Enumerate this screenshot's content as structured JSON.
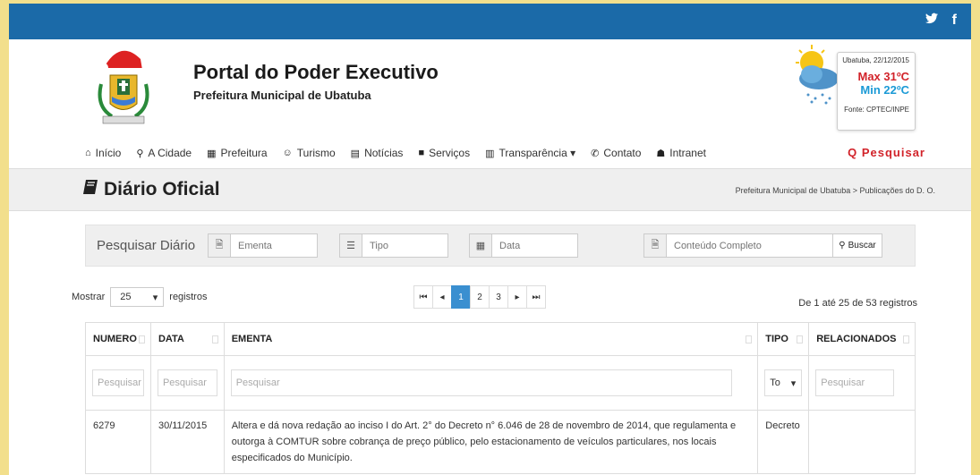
{
  "social": {
    "twitter": "𝕪",
    "facebook": "f"
  },
  "header": {
    "title": "Portal do Poder Executivo",
    "subtitle": "Prefeitura Municipal de Ubatuba"
  },
  "weather": {
    "location_date": "Ubatuba, 22/12/2015",
    "max": "Max 31ºC",
    "min": "Min 22ºC",
    "source": "Fonte: CPTEC/INPE"
  },
  "nav": {
    "items": [
      {
        "icon": "home-icon",
        "label": "Início"
      },
      {
        "icon": "map-marker-icon",
        "label": "A Cidade"
      },
      {
        "icon": "building-icon",
        "label": "Prefeitura"
      },
      {
        "icon": "smiley-icon",
        "label": "Turismo"
      },
      {
        "icon": "newspaper-icon",
        "label": "Notícias"
      },
      {
        "icon": "briefcase-icon",
        "label": "Serviços"
      },
      {
        "icon": "bar-chart-icon",
        "label": "Transparência ▾"
      },
      {
        "icon": "phone-icon",
        "label": "Contato"
      },
      {
        "icon": "group-icon",
        "label": "Intranet"
      }
    ],
    "search": "Q Pesquisar"
  },
  "page": {
    "title": "Diário Oficial",
    "breadcrumb": "Prefeitura Municipal de Ubatuba > Publicações do D. O."
  },
  "filters": {
    "label": "Pesquisar Diário",
    "ementa_placeholder": "Ementa",
    "tipo_placeholder": "Tipo",
    "data_placeholder": "Data",
    "conteudo_placeholder": "Conteúdo Completo",
    "buscar": "Buscar"
  },
  "listing": {
    "show_label": "Mostrar",
    "page_size": "25",
    "records_label": "registros",
    "pages": [
      "1",
      "2",
      "3"
    ],
    "current_page": "1",
    "info": "De 1 até 25 de 53 registros"
  },
  "table": {
    "headers": [
      "NUMERO",
      "DATA",
      "EMENTA",
      "TIPO",
      "RELACIONADOS"
    ],
    "filter_placeholder": "Pesquisar",
    "tipo_filter": "To",
    "rows": [
      {
        "numero": "6279",
        "data": "30/11/2015",
        "ementa": "Altera e dá nova redação ao inciso I do Art. 2° do Decreto n° 6.046 de 28 de novembro de 2014, que regulamenta e outorga à COMTUR sobre cobrança de preço público, pelo estacionamento de veículos particulares, nos locais especificados do Município.",
        "tipo": "Decreto",
        "relacionados": ""
      }
    ]
  },
  "colors": {
    "topbar": "#1b6aa8",
    "background": "#f2df8c",
    "accent_red": "#d2232a",
    "accent_blue": "#1b9ad6",
    "pager_active": "#3a8fd0"
  }
}
